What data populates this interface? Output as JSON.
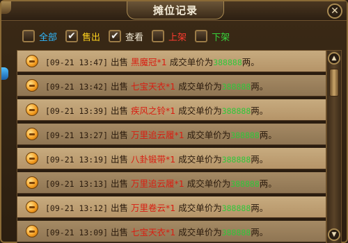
{
  "window": {
    "title": "摊位记录",
    "close_glyph": "✕"
  },
  "filters": [
    {
      "label": "全部",
      "checked": false,
      "color": "#2fb8ff"
    },
    {
      "label": "售出",
      "checked": true,
      "color": "#ffd21e"
    },
    {
      "label": "查看",
      "checked": true,
      "color": "#f4ecd8"
    },
    {
      "label": "上架",
      "checked": false,
      "color": "#ff3b2f"
    },
    {
      "label": "下架",
      "checked": false,
      "color": "#38d43c"
    }
  ],
  "records": [
    {
      "time": "[09-21 13:47]",
      "action": "出售",
      "item": "黑魔冠*1",
      "prefix": "成交单价为",
      "price": "388888",
      "suffix": "两。"
    },
    {
      "time": "[09-21 13:42]",
      "action": "出售",
      "item": "七宝天衣*1",
      "prefix": "成交单价为",
      "price": "388888",
      "suffix": "两。"
    },
    {
      "time": "[09-21 13:39]",
      "action": "出售",
      "item": "疾风之铃*1",
      "prefix": "成交单价为",
      "price": "388888",
      "suffix": "两。"
    },
    {
      "time": "[09-21 13:27]",
      "action": "出售",
      "item": "万里追云履*1",
      "prefix": "成交单价为",
      "price": "388888",
      "suffix": "两。"
    },
    {
      "time": "[09-21 13:19]",
      "action": "出售",
      "item": "八卦锻带*1",
      "prefix": "成交单价为",
      "price": "388888",
      "suffix": "两。"
    },
    {
      "time": "[09-21 13:13]",
      "action": "出售",
      "item": "万里追云履*1",
      "prefix": "成交单价为",
      "price": "388888",
      "suffix": "两。"
    },
    {
      "time": "[09-21 13:12]",
      "action": "出售",
      "item": "万里卷云*1",
      "prefix": "成交单价为",
      "price": "388888",
      "suffix": "两。"
    },
    {
      "time": "[09-21 13:09]",
      "action": "出售",
      "item": "七宝天衣*1",
      "prefix": "成交单价为",
      "price": "388888",
      "suffix": "两。"
    }
  ],
  "scrollbar": {
    "up_glyph": "▲",
    "down_glyph": "▼"
  },
  "colors": {
    "item_name": "#d81e12",
    "price": "#2fc83a",
    "row_light": "#c7ab7f",
    "row_dark": "#a58a64",
    "frame_gold": "#a98a52"
  }
}
